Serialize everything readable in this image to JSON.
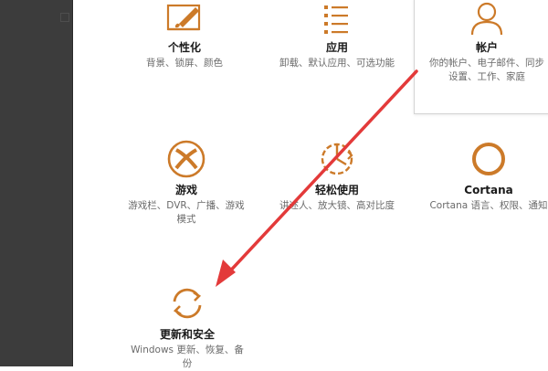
{
  "colors": {
    "accent": "#cc7a29",
    "arrow": "#e33a3a",
    "sidebar": "#3c3c3c"
  },
  "tiles": [
    {
      "icon": "personalization-icon",
      "title": "个性化",
      "desc": "背景、锁屏、颜色"
    },
    {
      "icon": "apps-icon",
      "title": "应用",
      "desc": "卸载、默认应用、可选功能"
    },
    {
      "icon": "accounts-icon",
      "title": "帐户",
      "desc_line1": "你的帐户、电子邮件、同步",
      "desc_line2": "设置、工作、家庭"
    },
    {
      "icon": "xbox-gaming-icon",
      "title": "游戏",
      "desc_line1": "游戏栏、DVR、广播、游戏",
      "desc_line2": "模式"
    },
    {
      "icon": "ease-of-access-icon",
      "title": "轻松使用",
      "desc": "讲述人、放大镜、高对比度"
    },
    {
      "icon": "cortana-icon",
      "title": "Cortana",
      "desc": "Cortana 语言、权限、通知"
    },
    {
      "icon": "update-security-icon",
      "title": "更新和安全",
      "desc_line1": "Windows 更新、恢复、备",
      "desc_line2": "份"
    }
  ]
}
